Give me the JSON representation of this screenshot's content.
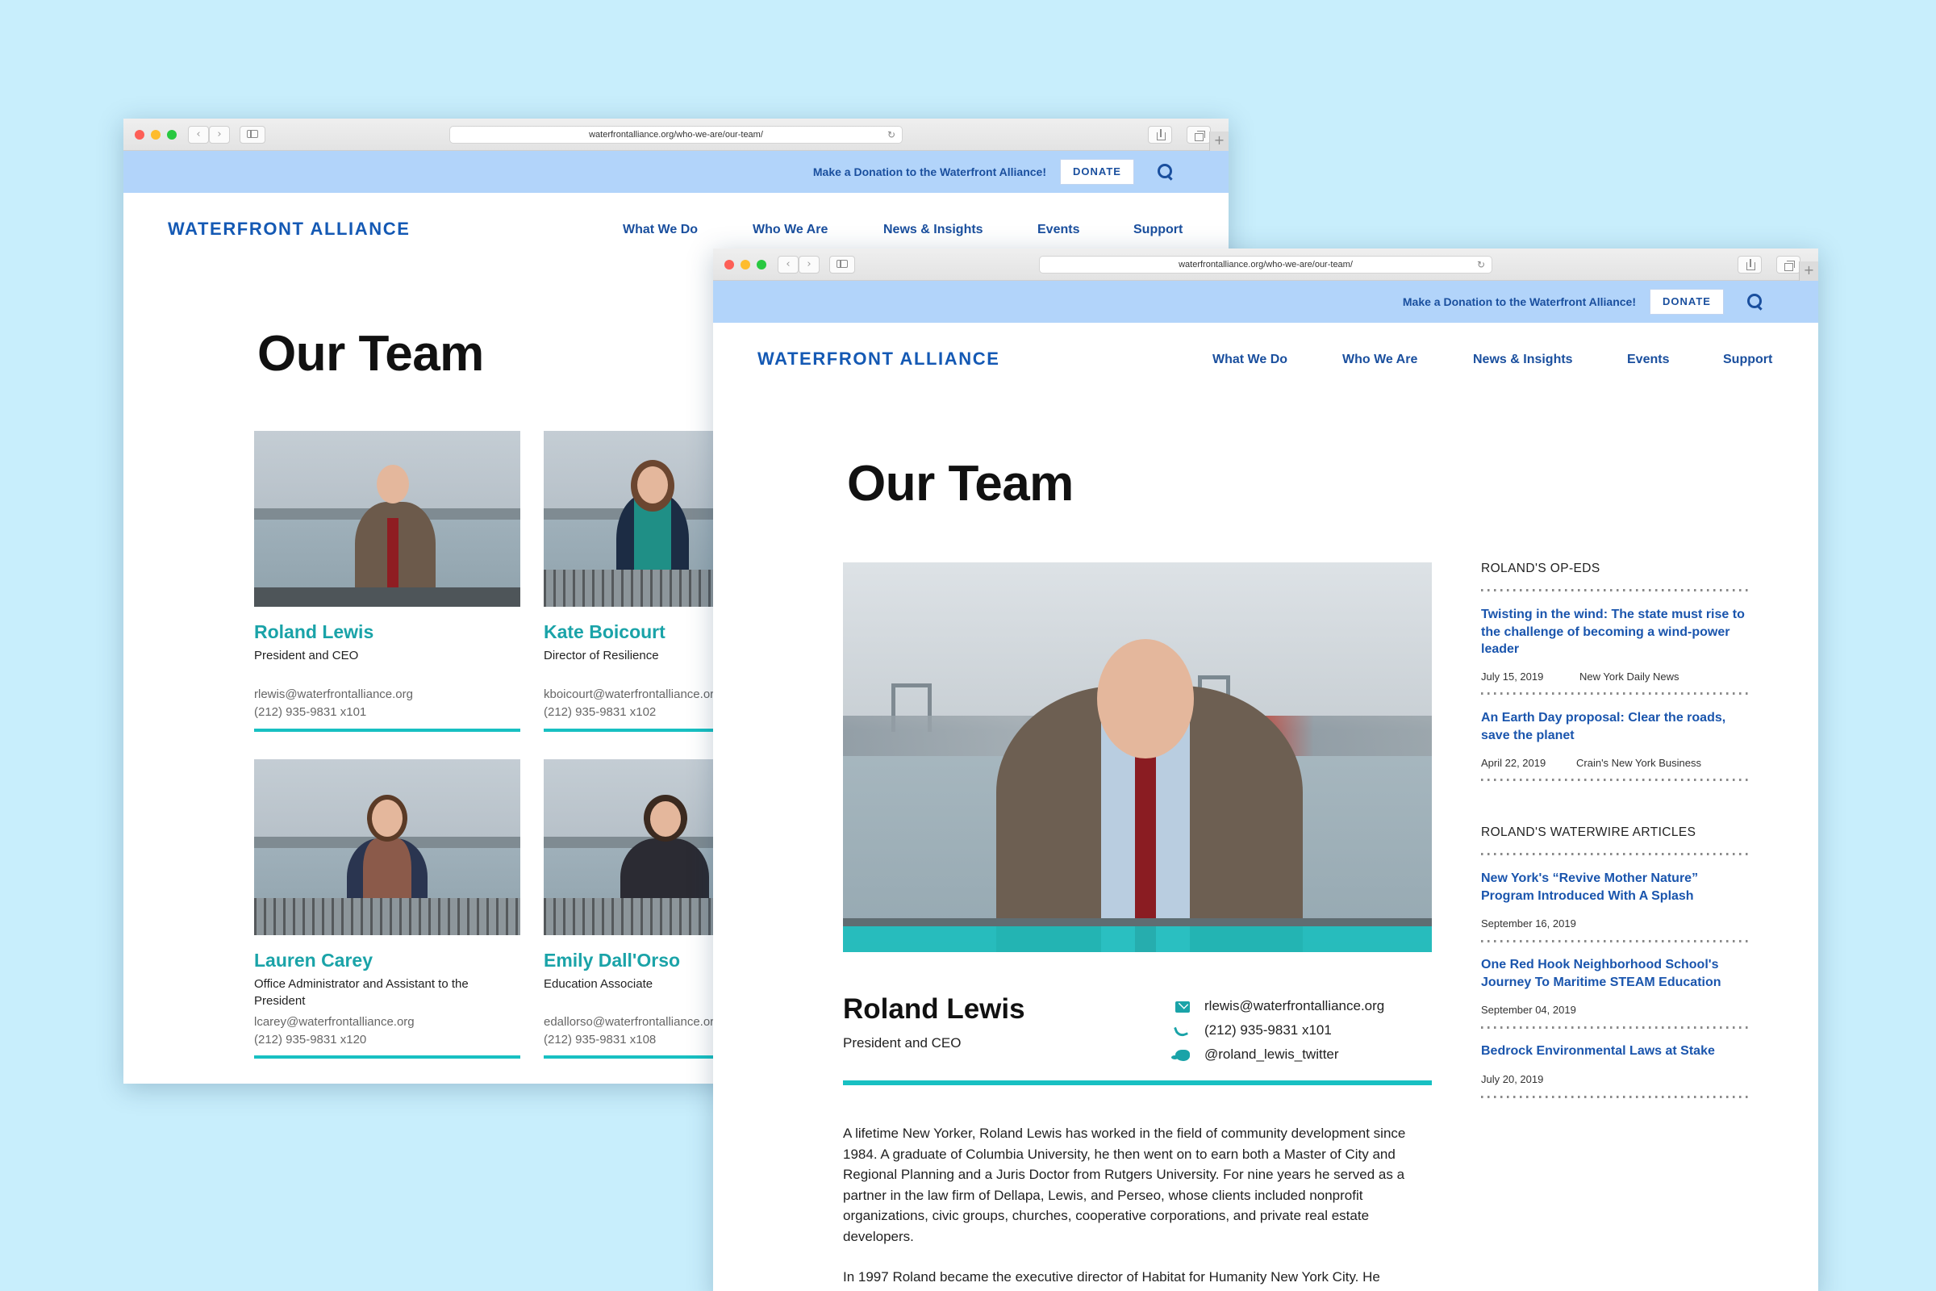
{
  "browser": {
    "url": "waterfrontalliance.org/who-we-are/our-team/"
  },
  "site": {
    "donate_message": "Make a Donation to the Waterfront Alliance!",
    "donate_label": "DONATE",
    "logo": "WATERFRONT ALLIANCE",
    "nav": [
      "What We Do",
      "Who We Are",
      "News & Insights",
      "Events",
      "Support"
    ]
  },
  "team_page": {
    "title": "Our Team",
    "members": [
      {
        "name": "Roland Lewis",
        "role": "President and CEO",
        "email": "rlewis@waterfrontalliance.org",
        "phone": "(212) 935-9831 x101"
      },
      {
        "name": "Kate Boicourt",
        "role": "Director of Resilience",
        "email": "kboicourt@waterfrontalliance.org",
        "phone": "(212) 935-9831 x102"
      },
      {
        "name": "Lauren Carey",
        "role": "Office Administrator and Assistant to the President",
        "email": "lcarey@waterfrontalliance.org",
        "phone": "(212) 935-9831 x120"
      },
      {
        "name": "Emily Dall'Orso",
        "role": "Education Associate",
        "email": "edallorso@waterfrontalliance.org",
        "phone": "(212) 935-9831 x108"
      }
    ]
  },
  "profile_page": {
    "title": "Our Team",
    "name": "Roland Lewis",
    "role": "President and CEO",
    "email": "rlewis@waterfrontalliance.org",
    "phone": "(212) 935-9831 x101",
    "twitter": "@roland_lewis_twitter",
    "bio": [
      "A lifetime New Yorker, Roland Lewis has worked in the field of community development since 1984. A graduate of Columbia University, he then went on to earn both a Master of City and Regional Planning and a Juris Doctor from Rutgers University. For nine years he served as a partner in the law firm of Dellapa, Lewis, and Perseo, whose clients included nonprofit organizations, civic groups, churches, cooperative corporations, and private real estate developers.",
      "In 1997 Roland became the executive director of Habitat for Humanity New York City. He"
    ],
    "sidebar": {
      "oped_heading": "ROLAND'S OP-EDS",
      "opeds": [
        {
          "title": "Twisting in the wind: The state must rise to the challenge of becoming a wind-power leader",
          "date": "July 15, 2019",
          "source": "New York Daily News"
        },
        {
          "title": "An Earth Day proposal: Clear the roads, save the planet",
          "date": "April 22, 2019",
          "source": "Crain's New York Business"
        }
      ],
      "articles_heading": "ROLAND'S WATERWIRE ARTICLES",
      "articles": [
        {
          "title": "New York's “Revive Mother Nature” Program Introduced With A Splash",
          "date": "September 16, 2019"
        },
        {
          "title": "One Red Hook Neighborhood School's Journey To Maritime STEAM Education",
          "date": "September 04, 2019"
        },
        {
          "title": "Bedrock Environmental Laws at Stake",
          "date": "July 20, 2019"
        }
      ]
    }
  },
  "icons": {
    "back": "‹",
    "forward": "›",
    "reload": "↻",
    "new_tab": "+"
  },
  "colors": {
    "background": "#c8eefc",
    "topbar": "#b2d4fa",
    "brand_blue": "#1459b4",
    "accent_teal": "#18c0c2",
    "name_teal": "#1aa3a8"
  }
}
